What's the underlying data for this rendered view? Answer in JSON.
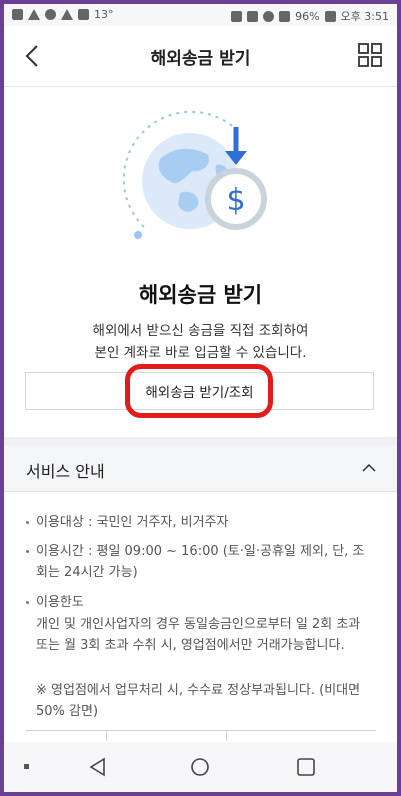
{
  "status_bar": {
    "temperature": "13°",
    "battery": "96%",
    "time": "오후 3:51"
  },
  "header": {
    "title": "해외송금 받기",
    "back_icon": "chevron-left-icon",
    "menu_icon": "grid-menu-icon"
  },
  "hero": {
    "illustration": "globe-dollar-icon",
    "title": "해외송금 받기",
    "desc_line1": "해외에서 받으신 송금을 직접 조회하여",
    "desc_line2": "본인 계좌로 바로 입금할 수 있습니다.",
    "button_label": "해외송금 받기/조회"
  },
  "service": {
    "title": "서비스 안내",
    "items": [
      {
        "text": "이용대상 : 국민인 거주자, 비거주자"
      },
      {
        "text": "이용시간 : 평일 09:00 ~ 16:00 (토·일·공휴일 제외, 단, 조회는 24시간 가능)"
      },
      {
        "text": "이용한도"
      },
      {
        "text": "개인 및 개인사업자의 경우 동일송금인으로부터 일 2회 초과 또는 월 3회 초과 수취 시, 영업점에서만 거래가능합니다."
      },
      {
        "text": "※ 영업점에서 업무처리 시, 수수료 정상부과됩니다. (비대면 50% 감면)"
      }
    ]
  },
  "colors": {
    "frame": "#6b3f93",
    "accent_blue": "#2f6fd6",
    "annotation_red": "#e31b1b"
  }
}
